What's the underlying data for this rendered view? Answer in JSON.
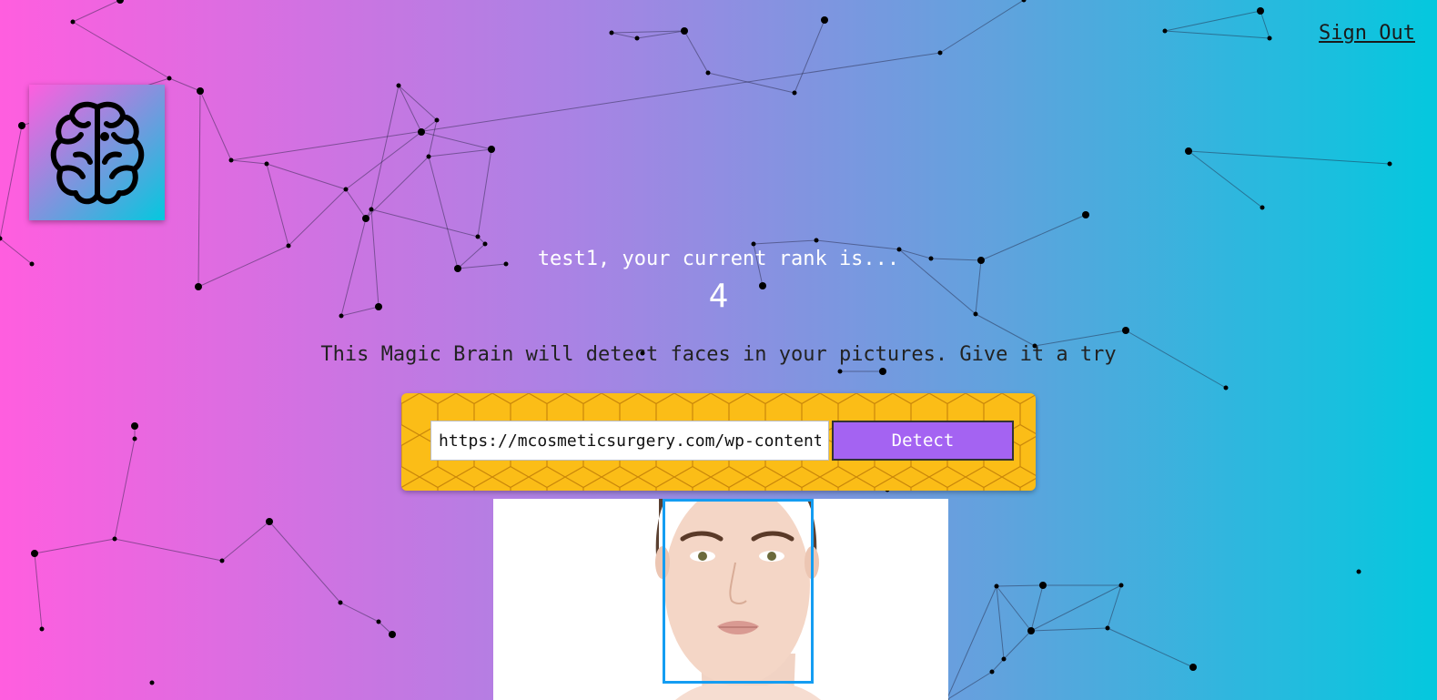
{
  "header": {
    "sign_out_label": "Sign Out"
  },
  "logo": {
    "icon": "brain-icon"
  },
  "rank": {
    "message": "test1, your current rank is...",
    "value": "4"
  },
  "intro": {
    "text": "This Magic Brain will detect faces in your pictures. Give it a try"
  },
  "image_form": {
    "url_value": "https://mcosmeticsurgery.com/wp-content",
    "detect_label": "Detect"
  },
  "result_image": {
    "face_box_visible": true
  },
  "colors": {
    "gradient_start": "#ff5edf",
    "gradient_end": "#04c8de",
    "form_background": "#fbbd17",
    "button_purple": "#a463f2",
    "face_box": "#149df2"
  }
}
